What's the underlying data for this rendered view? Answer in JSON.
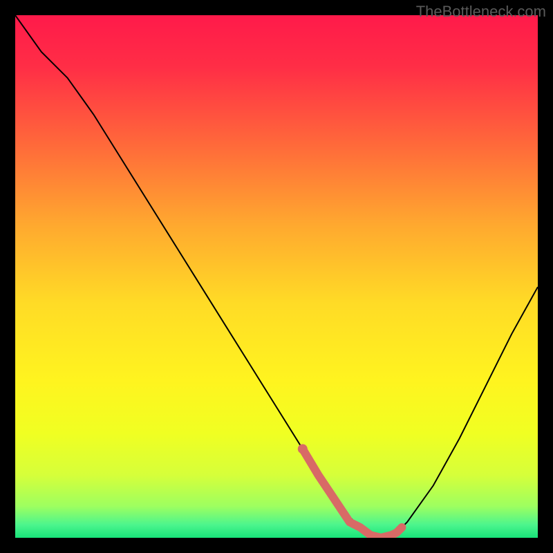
{
  "watermark": "TheBottleneck.com",
  "chart_data": {
    "type": "line",
    "title": "",
    "xlabel": "",
    "ylabel": "",
    "xlim": [
      0,
      100
    ],
    "ylim": [
      0,
      100
    ],
    "x": [
      0,
      5,
      10,
      15,
      20,
      25,
      30,
      35,
      40,
      45,
      50,
      55,
      60,
      63,
      66,
      70,
      73,
      75,
      80,
      85,
      90,
      95,
      100
    ],
    "curve_values": [
      100,
      93,
      88,
      81,
      73,
      65,
      57,
      49,
      41,
      33,
      25,
      17,
      9,
      5,
      2,
      0,
      1,
      3,
      10,
      19,
      29,
      39,
      48
    ],
    "highlight": {
      "x": [
        55,
        58,
        60,
        62,
        64,
        66,
        68,
        70,
        72,
        73,
        74
      ],
      "values": [
        17,
        12,
        9,
        6,
        3,
        2,
        0.5,
        0,
        0.5,
        1,
        2
      ]
    },
    "gradient_stops": [
      {
        "offset": 0.0,
        "color": "#ff1a4a"
      },
      {
        "offset": 0.1,
        "color": "#ff2e46"
      },
      {
        "offset": 0.25,
        "color": "#ff6a3a"
      },
      {
        "offset": 0.4,
        "color": "#ffa82f"
      },
      {
        "offset": 0.55,
        "color": "#ffdb26"
      },
      {
        "offset": 0.7,
        "color": "#fff41f"
      },
      {
        "offset": 0.8,
        "color": "#f0ff22"
      },
      {
        "offset": 0.88,
        "color": "#d6ff3a"
      },
      {
        "offset": 0.94,
        "color": "#9dff60"
      },
      {
        "offset": 0.975,
        "color": "#4cf58d"
      },
      {
        "offset": 1.0,
        "color": "#18e37a"
      }
    ],
    "curve_color": "#000000",
    "highlight_color": "#d86a66"
  }
}
